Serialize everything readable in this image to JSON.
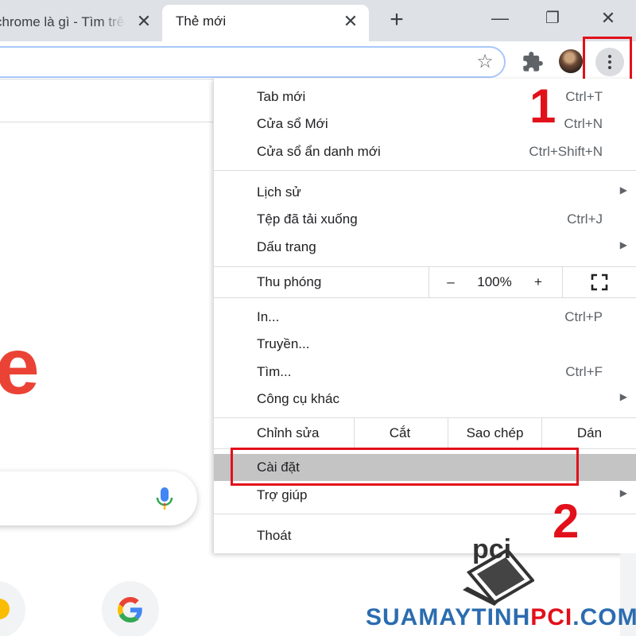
{
  "tabs": [
    {
      "title": "chrome là gì - Tìm trên Google",
      "close": "✕"
    },
    {
      "title": "Thẻ mới",
      "close": "✕"
    }
  ],
  "tabstrip": {
    "new_tab": "+",
    "minimize": "—",
    "restore": "❐",
    "close": "✕"
  },
  "toolbar": {
    "star_icon": "☆"
  },
  "menu": {
    "group1": [
      {
        "label": "Tab mới",
        "shortcut": "Ctrl+T"
      },
      {
        "label": "Cửa sổ Mới",
        "shortcut": "Ctrl+N"
      },
      {
        "label": "Cửa sổ ẩn danh mới",
        "shortcut": "Ctrl+Shift+N"
      }
    ],
    "group2": [
      {
        "label": "Lịch sử",
        "submenu": true
      },
      {
        "label": "Tệp đã tải xuống",
        "shortcut": "Ctrl+J"
      },
      {
        "label": "Dấu trang",
        "submenu": true
      }
    ],
    "zoom": {
      "label": "Thu phóng",
      "minus": "–",
      "value": "100%",
      "plus": "+"
    },
    "group3": [
      {
        "label": "In...",
        "shortcut": "Ctrl+P"
      },
      {
        "label": "Truyền..."
      },
      {
        "label": "Tìm...",
        "shortcut": "Ctrl+F"
      },
      {
        "label": "Công cụ khác",
        "submenu": true
      }
    ],
    "edit": {
      "label": "Chỉnh sửa",
      "cut": "Cắt",
      "copy": "Sao chép",
      "paste": "Dán"
    },
    "group4": [
      {
        "label": "Cài đặt",
        "highlighted": true
      },
      {
        "label": "Trợ giúp",
        "submenu": true
      }
    ],
    "exit": {
      "label": "Thoát"
    },
    "submenu_arrow": "▶"
  },
  "annotations": {
    "step1": "1",
    "step2": "2"
  },
  "page": {
    "logo_fragment": "e"
  },
  "watermark": {
    "part1": "SUAMAYTINH",
    "part2": "PCI",
    "part3": ".COM",
    "logo_text": "pci"
  },
  "colors": {
    "highlight_box": "#e2101a",
    "menu_hover": "#c4c4c4",
    "tabstrip": "#dee1e6"
  }
}
